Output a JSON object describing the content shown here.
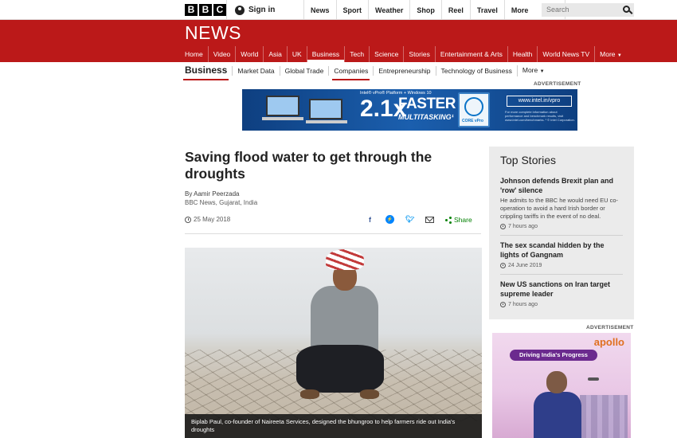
{
  "topbar": {
    "logo_letters": [
      "B",
      "B",
      "C"
    ],
    "signin_label": "Sign in",
    "nav": [
      "News",
      "Sport",
      "Weather",
      "Shop",
      "Reel",
      "Travel"
    ],
    "more_label": "More",
    "search_placeholder": "Search"
  },
  "newsband": {
    "title": "NEWS",
    "nav": [
      "Home",
      "Video",
      "World",
      "Asia",
      "UK",
      "Business",
      "Tech",
      "Science",
      "Stories",
      "Entertainment & Arts",
      "Health",
      "World News TV",
      "More"
    ],
    "active": "Business",
    "accent": "#bb1919"
  },
  "subnav": {
    "section": "Business",
    "items": [
      "Market Data",
      "Global Trade",
      "Companies",
      "Entrepreneurship",
      "Technology of Business"
    ],
    "active": "Companies",
    "more_label": "More"
  },
  "ads": {
    "label": "ADVERTISEMENT",
    "intel": {
      "tagline": "Intel® vPro® Platform + Windows 10",
      "big_number": "2.1x",
      "faster": "FASTER",
      "multitasking": "MULTITASKING¹",
      "badge_text": "CORE vPro",
      "url": "www.intel.in/vpro",
      "fine_print": "For more complete information about performance and benchmark results, visit www.intel.com/benchmarks. ¹ © Intel Corporation."
    },
    "apollo": {
      "brand": "apollo",
      "tagline": "Driving India's Progress"
    }
  },
  "article": {
    "headline": "Saving flood water to get through the droughts",
    "author": "By Aamir Peerzada",
    "org": "BBC News, Gujarat, India",
    "date": "25 May 2018",
    "share_label": "Share",
    "share_icons": [
      "facebook-icon",
      "messenger-icon",
      "twitter-icon",
      "email-icon"
    ],
    "caption": "Biplab Paul, co-founder of Naireeta Services, designed the bhungroo to help farmers ride out India's droughts"
  },
  "top_stories": {
    "heading": "Top Stories",
    "stories": [
      {
        "title": "Johnson defends Brexit plan and 'row' silence",
        "summary": "He admits to the BBC he would need EU co-operation to avoid a hard Irish border or crippling tariffs in the event of no deal.",
        "time": "7 hours ago"
      },
      {
        "title": "The sex scandal hidden by the lights of Gangnam",
        "summary": "",
        "time": "24 June 2019"
      },
      {
        "title": "New US sanctions on Iran target supreme leader",
        "summary": "",
        "time": "7 hours ago"
      }
    ]
  }
}
